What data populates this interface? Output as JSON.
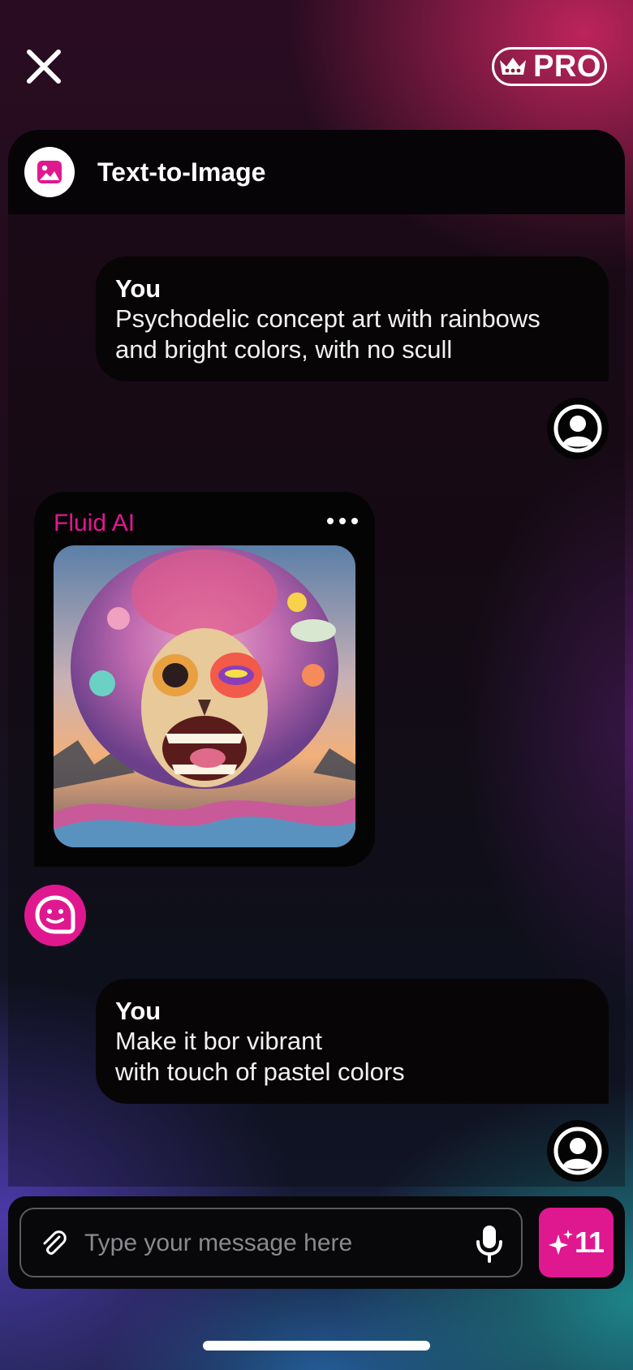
{
  "top_bar": {
    "pro_label": "PRO"
  },
  "panel": {
    "title": "Text-to-Image",
    "messages": [
      {
        "author": "You",
        "text": "Psychodelic concept art with rainbows\nand bright colors, with no scull"
      },
      {
        "author": "Fluid AI",
        "image_icon": "psychedelic-skull-artwork"
      },
      {
        "author": "You",
        "text": "Make it bor vibrant\nwith touch of pastel colors"
      }
    ]
  },
  "composer": {
    "placeholder": "Type your message here",
    "credits": "11"
  },
  "colors": {
    "accent": "#e0188f",
    "bubble": "#070506"
  }
}
